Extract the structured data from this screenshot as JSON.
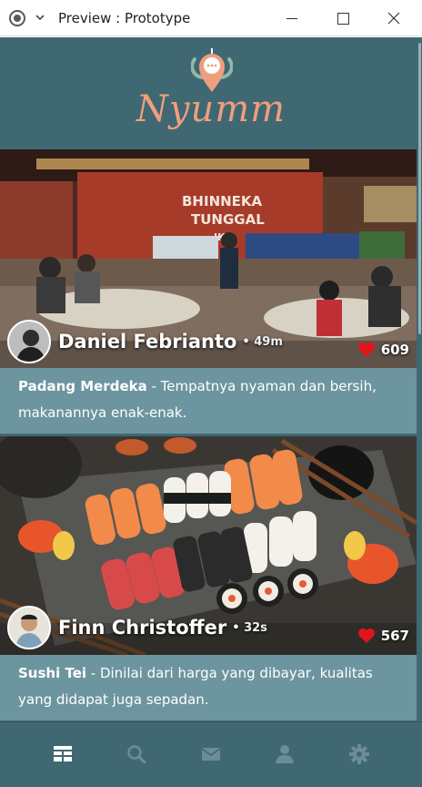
{
  "window": {
    "title": "Preview : Prototype"
  },
  "app": {
    "logo_text": "Nyumm"
  },
  "feed": [
    {
      "author": "Daniel Febrianto",
      "time": "• 49m",
      "likes": "609",
      "place": "Padang Merdeka",
      "review": " - Tempatnya nyaman dan bersih, makanannya enak-enak.",
      "photo_icon": "restaurant-photo"
    },
    {
      "author": "Finn Christoffer",
      "time": "• 32s",
      "likes": "567",
      "place": "Sushi Tei",
      "review": " - Dinilai dari harga yang dibayar, kualitas yang didapat juga sepadan.",
      "photo_icon": "sushi-photo"
    }
  ],
  "restaurant_sign": [
    "BHINNEKA",
    "TUNGGAL",
    "IKA"
  ],
  "colors": {
    "app_bg": "#3f6872",
    "caption_bg": "#6d959f",
    "accent": "#ef9e7e",
    "heart": "#e0151b",
    "nav_active": "#ffffff",
    "nav_inactive": "#6d8d96"
  },
  "nav": [
    {
      "icon": "feed-icon",
      "active": true
    },
    {
      "icon": "search-icon",
      "active": false
    },
    {
      "icon": "mail-icon",
      "active": false
    },
    {
      "icon": "profile-icon",
      "active": false
    },
    {
      "icon": "settings-icon",
      "active": false
    }
  ]
}
